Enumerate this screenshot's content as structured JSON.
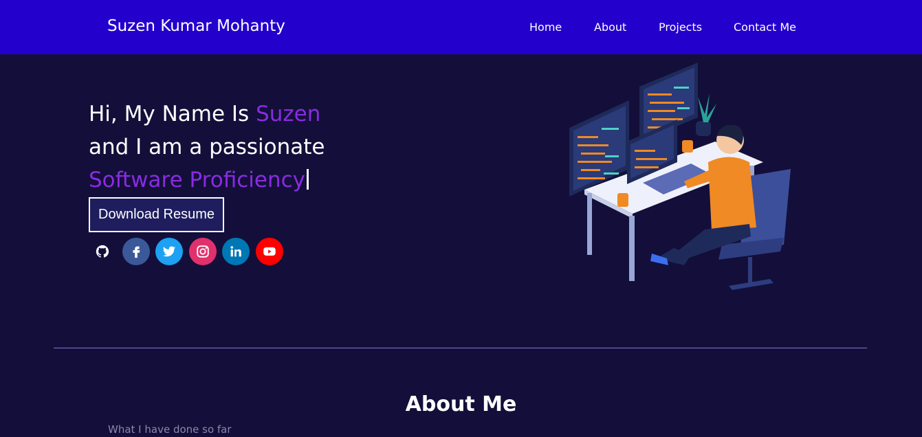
{
  "header": {
    "brand": "Suzen Kumar Mohanty",
    "nav": [
      {
        "label": "Home"
      },
      {
        "label": "About"
      },
      {
        "label": "Projects"
      },
      {
        "label": "Contact Me"
      }
    ]
  },
  "hero": {
    "line1_prefix": "Hi, My Name Is ",
    "line1_name": "Suzen",
    "line2": "and I am a passionate",
    "line3_role": "Software Proficiency",
    "resume_button": "Download Resume",
    "socials": [
      {
        "icon": "github-icon",
        "color": "#130f3a"
      },
      {
        "icon": "facebook-icon",
        "color": "#3b5998"
      },
      {
        "icon": "twitter-icon",
        "color": "#1da1f2"
      },
      {
        "icon": "instagram-icon",
        "color": "#e1306c"
      },
      {
        "icon": "linkedin-icon",
        "color": "#0077b5"
      },
      {
        "icon": "youtube-icon",
        "color": "#ff0000"
      }
    ]
  },
  "about": {
    "title": "About Me",
    "subtitle": "What I have done so far"
  },
  "colors": {
    "background": "#130f3a",
    "navbar": "#2400cc",
    "accent": "#8a2be2"
  }
}
